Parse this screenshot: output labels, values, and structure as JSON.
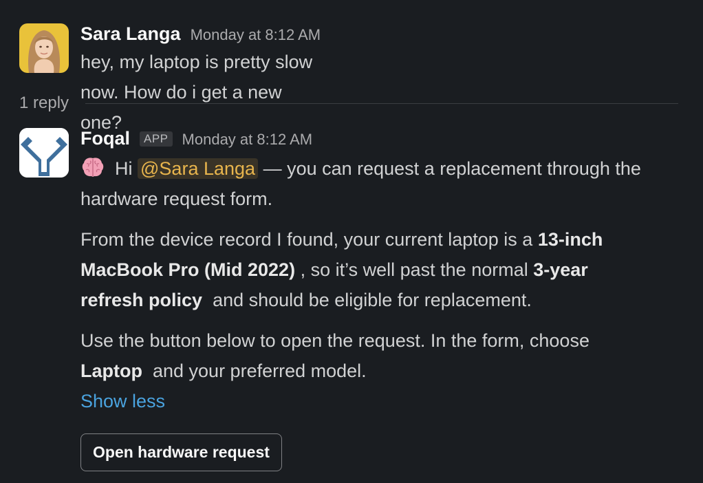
{
  "messages": [
    {
      "sender": "Sara Langa",
      "timestamp": "Monday at 8:12 AM",
      "text": "hey, my laptop is pretty slow now. How do i get a new one?"
    },
    {
      "sender": "Foqal",
      "badge": "APP",
      "timestamp": "Monday at 8:12 AM",
      "emoji": "brain-icon",
      "greeting": "Hi",
      "mention": "@Sara Langa",
      "intro_rest": "— you can request a replacement through the",
      "intro_line2": "hardware request form.",
      "p2": {
        "a": "From the device record I found, your current laptop is a ",
        "b": "13-inch",
        "c": "MacBook Pro (Mid 2022)",
        "d": " , so it’s well past the normal ",
        "e": "3-year",
        "f": "refresh policy",
        "g": "  and should be eligible for replacement."
      },
      "p3": {
        "a": "Use the button below to open the request. In the form, choose",
        "b": "Laptop",
        "c": "  and your preferred model."
      },
      "show_less": "Show less",
      "button_label": "Open hardware request"
    }
  ],
  "thread": {
    "reply_count": "1 reply"
  },
  "colors": {
    "background": "#1a1d21",
    "mention": "#e8b54d",
    "link": "#4aa3df",
    "foqal_logo": "#3f6f9c"
  }
}
